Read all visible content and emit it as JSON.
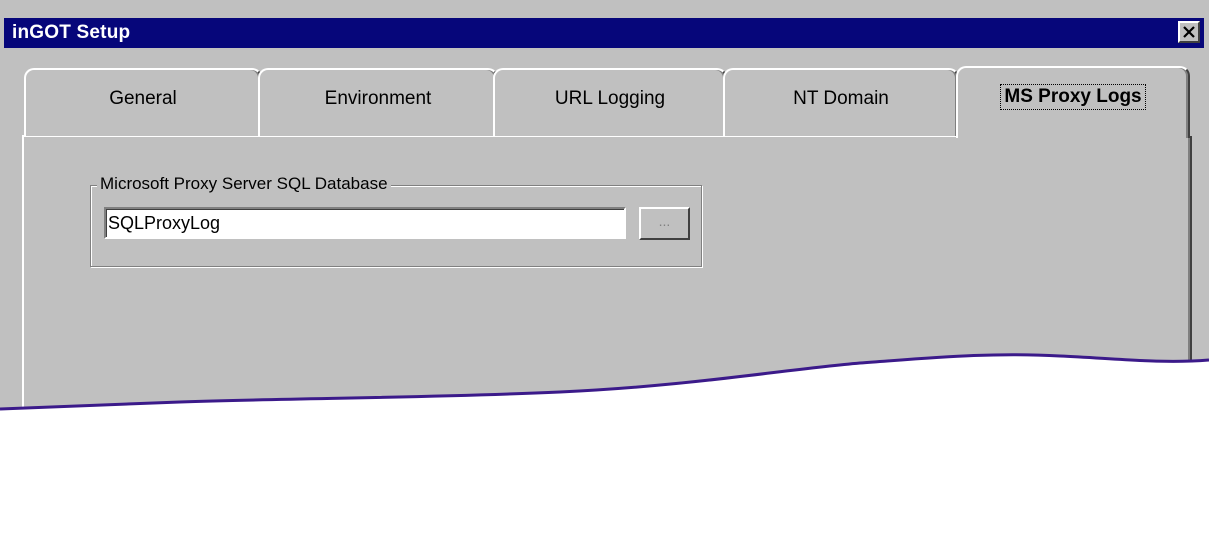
{
  "window": {
    "title": "inGOT Setup"
  },
  "tabs": [
    {
      "label": "General",
      "active": false
    },
    {
      "label": "Environment",
      "active": false
    },
    {
      "label": "URL Logging",
      "active": false
    },
    {
      "label": "NT Domain",
      "active": false
    },
    {
      "label": "MS Proxy Logs",
      "active": true
    }
  ],
  "panel": {
    "group_label": "Microsoft Proxy Server SQL Database",
    "db_value": "SQLProxyLog",
    "browse_label": "..."
  },
  "icons": {
    "close": "close-icon"
  },
  "colors": {
    "title_bar": "#06067a",
    "dialog_face": "#c0c0c0",
    "wave_edge": "#3b1a8a"
  }
}
